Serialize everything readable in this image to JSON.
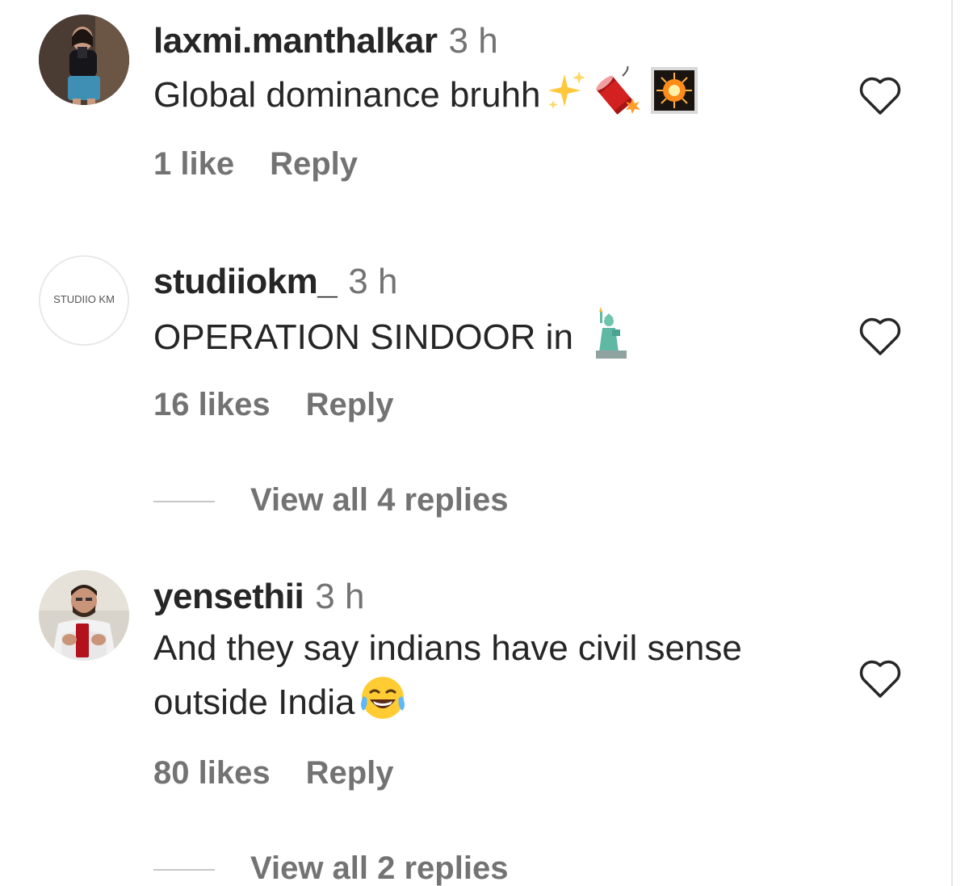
{
  "comments": [
    {
      "username": "laxmi.manthalkar",
      "time": "3 h",
      "text": "Global dominance bruhh",
      "emojis": [
        "sparkles-icon",
        "firecracker-icon",
        "fireworks-icon"
      ],
      "likes": "1 like",
      "reply_label": "Reply"
    },
    {
      "username": "studiiokm_",
      "time": "3 h",
      "avatar_text": "STUDIIO KM",
      "text": "OPERATION SINDOOR in",
      "emojis": [
        "statue-of-liberty-icon"
      ],
      "likes": "16 likes",
      "reply_label": "Reply",
      "view_replies": "View all 4 replies"
    },
    {
      "username": "yensethii",
      "time": "3 h",
      "text_line1": "And they say indians have civil sense",
      "text_line2": "outside India",
      "emojis": [
        "face-with-tears-of-joy-icon"
      ],
      "likes": "80 likes",
      "reply_label": "Reply",
      "view_replies": "View all 2 replies"
    }
  ],
  "icons": {
    "like": "heart-outline-icon"
  },
  "colors": {
    "primary_text": "#262626",
    "secondary_text": "#737373",
    "divider": "#c7c7c7"
  }
}
